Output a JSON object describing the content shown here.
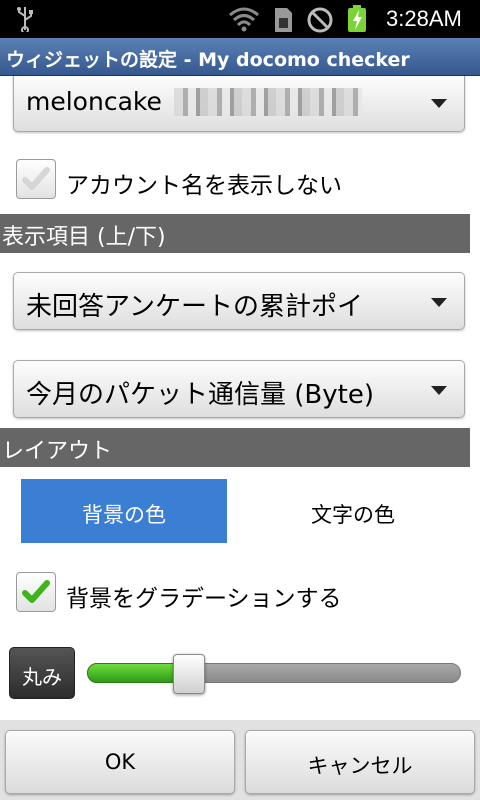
{
  "status_bar": {
    "time": "3:28AM",
    "icons": [
      "usb-icon",
      "wifi-icon",
      "sim-card-icon",
      "no-signal-icon",
      "battery-charging-icon"
    ]
  },
  "titlebar": {
    "title": "ウィジェットの設定 - My docomo checker"
  },
  "account": {
    "name": "meloncake",
    "hide_account_label": "アカウント名を表示しない",
    "hide_account_checked": false
  },
  "display_items": {
    "header": "表示項目 (上/下)",
    "upper_value": "未回答アンケートの累計ポイ",
    "lower_value": "今月のパケット通信量 (Byte)"
  },
  "layout": {
    "header": "レイアウト",
    "tabs": [
      {
        "label": "背景の色",
        "selected": true
      },
      {
        "label": "文字の色",
        "selected": false
      }
    ],
    "gradient_label": "背景をグラデーションする",
    "gradient_checked": true,
    "roundness_label": "丸み",
    "roundness_value_fraction": 0.25
  },
  "buttons": {
    "ok": "OK",
    "cancel": "キャンセル"
  },
  "colors": {
    "accent": "#3b7fd4",
    "section_header": "#666666",
    "slider_fill": "#4cbc2a",
    "titlebar": "#4a6fa5"
  }
}
